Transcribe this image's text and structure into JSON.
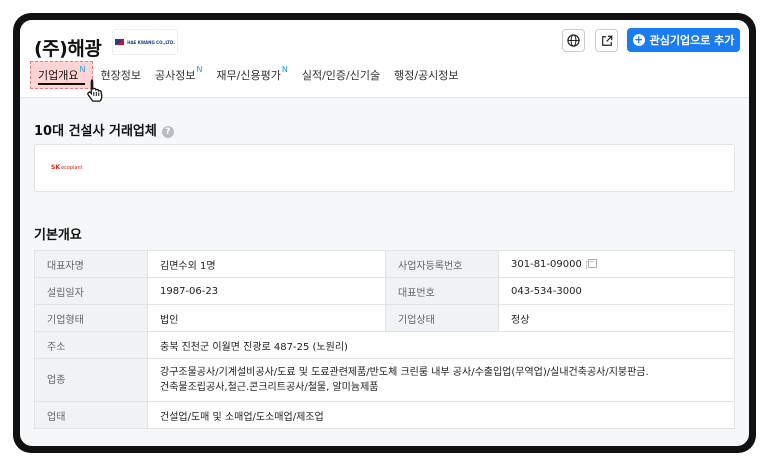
{
  "company": {
    "name": "(주)해광",
    "logo_text": "HAE KWANG CO.,LTD."
  },
  "header": {
    "fav_button": "관심기업으로 추가",
    "globe_icon": "globe-icon",
    "share_icon": "external-link-icon"
  },
  "tabs": [
    {
      "label": "기업개요",
      "sup": "N",
      "active": true
    },
    {
      "label": "현장정보",
      "sup": ""
    },
    {
      "label": "공사정보",
      "sup": "N"
    },
    {
      "label": "재무/신용평가",
      "sup": "N"
    },
    {
      "label": "실적/인증/신기술",
      "sup": ""
    },
    {
      "label": "행정/공시정보",
      "sup": ""
    }
  ],
  "top10": {
    "title": "10대 건설사 거래업체",
    "help": "?",
    "partners": [
      {
        "mark": "SK",
        "text": "ecoplant"
      }
    ]
  },
  "overview": {
    "title": "기본개요",
    "rows": {
      "ceo_label": "대표자명",
      "ceo": "김면수외 1명",
      "bizno_label": "사업자등록번호",
      "bizno": "301-81-09000",
      "founded_label": "설립일자",
      "founded": "1987-06-23",
      "phone_label": "대표번호",
      "phone": "043-534-3000",
      "type_label": "기업형태",
      "type": "법인",
      "status_label": "기업상태",
      "status": "정상",
      "address_label": "주소",
      "address": "충북 진천군 이월면 진광로 487-25 (노원리)",
      "industry_label": "업종",
      "industry_line1": "강구조물공사/기계설비공사/도료 및 도료관련제품/반도체 크린룸 내부 공사/수출입업(무역업)/실내건축공사/지붕판금.",
      "industry_line2": "건축물조립공사,철근.콘크리트공사/철물, 알미늄제품",
      "biztype_label": "업태",
      "biztype": "건설업/도매 및 소매업/도소매업/제조업"
    }
  },
  "colors": {
    "accent": "#1a7cf0",
    "new_badge": "#1a9de0"
  }
}
